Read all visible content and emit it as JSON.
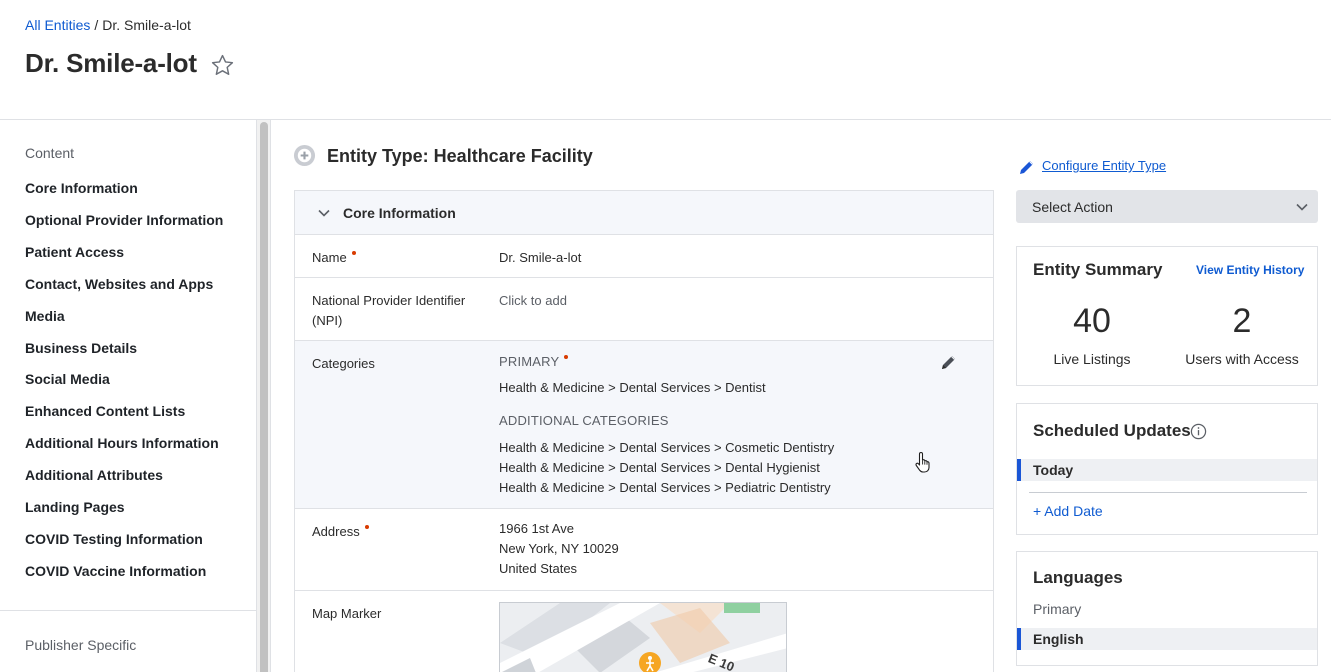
{
  "breadcrumb": {
    "root": "All Entities",
    "separator": "/",
    "current": "Dr. Smile-a-lot"
  },
  "page_title": "Dr. Smile-a-lot",
  "sidebar": {
    "heading": "Content",
    "items": [
      "Core Information",
      "Optional Provider Information",
      "Patient Access",
      "Contact, Websites and Apps",
      "Media",
      "Business Details",
      "Social Media",
      "Enhanced Content Lists",
      "Additional Hours Information",
      "Additional Attributes",
      "Landing Pages",
      "COVID Testing Information",
      "COVID Vaccine Information"
    ],
    "footer_heading": "Publisher Specific"
  },
  "entity_type": {
    "label": "Entity Type: Healthcare Facility"
  },
  "core_panel": {
    "title": "Core Information",
    "fields": {
      "name": {
        "label": "Name",
        "value": "Dr. Smile-a-lot"
      },
      "npi": {
        "label": "National Provider Identifier (NPI)",
        "placeholder": "Click to add"
      },
      "categories": {
        "label": "Categories",
        "primary_heading": "PRIMARY",
        "primary": "Health & Medicine > Dental Services > Dentist",
        "additional_heading": "ADDITIONAL CATEGORIES",
        "additional": [
          "Health & Medicine > Dental Services > Cosmetic Dentistry",
          "Health & Medicine > Dental Services > Dental Hygienist",
          "Health & Medicine > Dental Services > Pediatric Dentistry"
        ]
      },
      "address": {
        "label": "Address",
        "lines": [
          "1966 1st Ave",
          "New York, NY 10029",
          "United States"
        ]
      },
      "map_marker": {
        "label": "Map Marker",
        "street_label": "E 10"
      }
    }
  },
  "right": {
    "configure_link": "Configure Entity Type",
    "select_action": "Select Action",
    "summary": {
      "title": "Entity Summary",
      "history_link": "View Entity History",
      "stats": [
        {
          "value": "40",
          "label": "Live Listings"
        },
        {
          "value": "2",
          "label": "Users with Access"
        }
      ]
    },
    "scheduled": {
      "title": "Scheduled Updates",
      "selected": "Today",
      "add": "+ Add Date"
    },
    "languages": {
      "title": "Languages",
      "primary_label": "Primary",
      "selected": "English"
    }
  },
  "colors": {
    "link": "#0f5bd1",
    "required": "#d83b01",
    "selected_bar": "#1a56d6"
  },
  "icons": [
    "star-icon",
    "entity-type-icon",
    "chevron-down-icon",
    "pencil-icon",
    "info-icon",
    "hand-cursor-icon",
    "map-pin-icon"
  ]
}
